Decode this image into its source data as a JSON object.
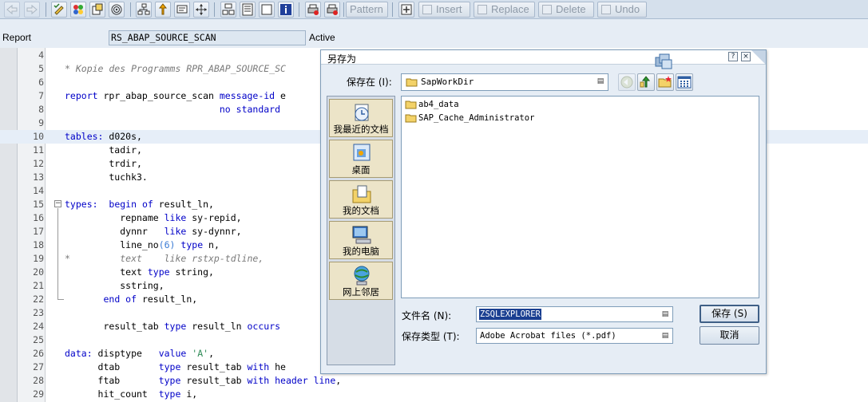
{
  "toolbar": {
    "icons": [
      "back-arrow-icon",
      "forward-arrow-icon",
      "check-syntax-icon",
      "activate-icon",
      "where-used-icon",
      "object-list-icon",
      "hierarchy-icon",
      "insert-statement-icon",
      "pattern-tools-icon",
      "navigation-icon",
      "block-icon",
      "split-screen-icon",
      "frame-icon",
      "info-icon",
      "print-icon",
      "find-icon"
    ],
    "pattern_label": "Pattern",
    "insert_label": "Insert",
    "replace_label": "Replace",
    "delete_label": "Delete",
    "undo_label": "Undo"
  },
  "report": {
    "label": "Report",
    "name": "RS_ABAP_SOURCE_SCAN",
    "status": "Active"
  },
  "editor": {
    "lines": [
      {
        "n": "4",
        "segments": []
      },
      {
        "n": "5",
        "segments": [
          {
            "t": "* Kopie des Programms RPR_ABAP_SOURCE_SC",
            "c": "cm"
          }
        ]
      },
      {
        "n": "6",
        "segments": []
      },
      {
        "n": "7",
        "segments": [
          {
            "t": "report",
            "c": "kw"
          },
          {
            "t": " rpr_abap_source_scan ",
            "c": ""
          },
          {
            "t": "message-id",
            "c": "kw"
          },
          {
            "t": " e",
            "c": ""
          }
        ]
      },
      {
        "n": "8",
        "segments": [
          {
            "t": "                            ",
            "c": ""
          },
          {
            "t": "no standard",
            "c": "kw"
          }
        ]
      },
      {
        "n": "9",
        "segments": []
      },
      {
        "n": "10",
        "segments": [
          {
            "t": "tables:",
            "c": "kw"
          },
          {
            "t": " d020s,",
            "c": ""
          }
        ]
      },
      {
        "n": "11",
        "segments": [
          {
            "t": "        tadir,",
            "c": ""
          }
        ]
      },
      {
        "n": "12",
        "segments": [
          {
            "t": "        trdir,",
            "c": ""
          }
        ]
      },
      {
        "n": "13",
        "segments": [
          {
            "t": "        tuchk3.",
            "c": ""
          }
        ]
      },
      {
        "n": "14",
        "segments": []
      },
      {
        "n": "15",
        "segments": [
          {
            "t": "types:",
            "c": "kw"
          },
          {
            "t": "  ",
            "c": ""
          },
          {
            "t": "begin of",
            "c": "kw"
          },
          {
            "t": " result_ln,",
            "c": ""
          }
        ]
      },
      {
        "n": "16",
        "segments": [
          {
            "t": "          repname ",
            "c": ""
          },
          {
            "t": "like",
            "c": "kw"
          },
          {
            "t": " sy-repid,",
            "c": ""
          }
        ]
      },
      {
        "n": "17",
        "segments": [
          {
            "t": "          dynnr   ",
            "c": ""
          },
          {
            "t": "like",
            "c": "kw"
          },
          {
            "t": " sy-dynnr,",
            "c": ""
          }
        ]
      },
      {
        "n": "18",
        "segments": [
          {
            "t": "          line_no",
            "c": ""
          },
          {
            "t": "(6)",
            "c": "nm"
          },
          {
            "t": " ",
            "c": ""
          },
          {
            "t": "type",
            "c": "kw"
          },
          {
            "t": " n,",
            "c": ""
          }
        ]
      },
      {
        "n": "19",
        "segments": [
          {
            "t": "*         text    like rstxp-tdline,",
            "c": "cm"
          }
        ]
      },
      {
        "n": "20",
        "segments": [
          {
            "t": "          text ",
            "c": ""
          },
          {
            "t": "type",
            "c": "kw"
          },
          {
            "t": " string,",
            "c": ""
          }
        ]
      },
      {
        "n": "21",
        "segments": [
          {
            "t": "          sstring,",
            "c": ""
          }
        ]
      },
      {
        "n": "22",
        "segments": [
          {
            "t": "       ",
            "c": ""
          },
          {
            "t": "end of",
            "c": "kw"
          },
          {
            "t": " result_ln,",
            "c": ""
          }
        ]
      },
      {
        "n": "23",
        "segments": []
      },
      {
        "n": "24",
        "segments": [
          {
            "t": "       result_tab ",
            "c": ""
          },
          {
            "t": "type",
            "c": "kw"
          },
          {
            "t": " result_ln ",
            "c": ""
          },
          {
            "t": "occurs",
            "c": "kw"
          }
        ]
      },
      {
        "n": "25",
        "segments": []
      },
      {
        "n": "26",
        "segments": [
          {
            "t": "data:",
            "c": "kw"
          },
          {
            "t": " disptype   ",
            "c": ""
          },
          {
            "t": "value",
            "c": "kw"
          },
          {
            "t": " ",
            "c": ""
          },
          {
            "t": "'A'",
            "c": "st"
          },
          {
            "t": ",",
            "c": ""
          }
        ]
      },
      {
        "n": "27",
        "segments": [
          {
            "t": "      dtab       ",
            "c": ""
          },
          {
            "t": "type",
            "c": "kw"
          },
          {
            "t": " result_tab ",
            "c": ""
          },
          {
            "t": "with",
            "c": "kw"
          },
          {
            "t": " he",
            "c": ""
          }
        ]
      },
      {
        "n": "28",
        "segments": [
          {
            "t": "      ftab       ",
            "c": ""
          },
          {
            "t": "type",
            "c": "kw"
          },
          {
            "t": " result_tab ",
            "c": ""
          },
          {
            "t": "with header line",
            "c": "kw"
          },
          {
            "t": ",",
            "c": ""
          }
        ]
      },
      {
        "n": "29",
        "segments": [
          {
            "t": "      hit_count  ",
            "c": ""
          },
          {
            "t": "type",
            "c": "kw"
          },
          {
            "t": " i,",
            "c": ""
          }
        ]
      }
    ],
    "highlighted_line": "10"
  },
  "dialog": {
    "title": "另存为",
    "help_glyph": "?",
    "close_glyph": "×",
    "save_in_label": "保存在 (I):",
    "save_in_value": "SapWorkDir",
    "places": [
      {
        "label": "我最近的文档",
        "icon": "recent-documents-icon"
      },
      {
        "label": "桌面",
        "icon": "desktop-icon"
      },
      {
        "label": "我的文档",
        "icon": "my-documents-icon"
      },
      {
        "label": "我的电脑",
        "icon": "my-computer-icon"
      },
      {
        "label": "网上邻居",
        "icon": "network-places-icon"
      }
    ],
    "files": [
      "ab4_data",
      "SAP_Cache_Administrator"
    ],
    "filename_label": "文件名 (N):",
    "filename_value": "ZSQLEXPLORER",
    "filetype_label": "保存类型 (T):",
    "filetype_value": "Adobe Acrobat files (*.pdf)",
    "save_button": "保存 (S)",
    "cancel_button": "取消"
  }
}
